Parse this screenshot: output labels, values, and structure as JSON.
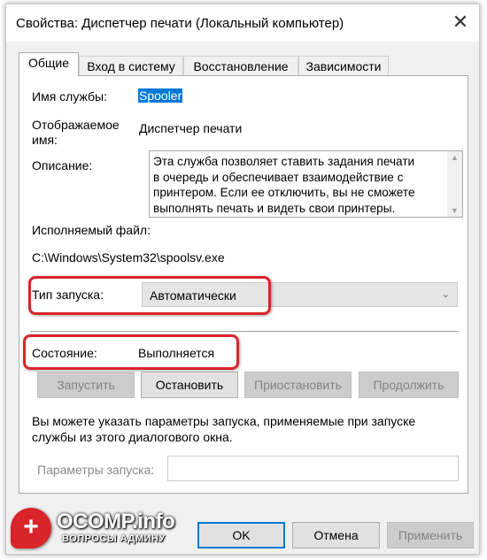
{
  "window": {
    "title": "Свойства: Диспетчер печати (Локальный компьютер)",
    "close_glyph": "✕"
  },
  "tabs": [
    {
      "label": "Общие"
    },
    {
      "label": "Вход в систему"
    },
    {
      "label": "Восстановление"
    },
    {
      "label": "Зависимости"
    }
  ],
  "general": {
    "service_name_label": "Имя службы:",
    "service_name_value": "Spooler",
    "display_name_label_1": "Отображаемое",
    "display_name_label_2": "имя:",
    "display_name_value": "Диспетчер печати",
    "description_label": "Описание:",
    "description_lines": [
      "Эта служба позволяет ставить задания печати",
      "в очередь и обеспечивает взаимодействие с",
      "принтером. Если ее отключить, вы не сможете",
      "выполнять печать и видеть свои принтеры."
    ],
    "exe_label": "Исполняемый файл:",
    "exe_path": "C:\\Windows\\System32\\spoolsv.exe",
    "startup_type_label": "Тип запуска:",
    "startup_type_value": "Автоматически",
    "status_label": "Состояние:",
    "status_value": "Выполняется",
    "start_button": "Запустить",
    "stop_button": "Остановить",
    "pause_button": "Приостановить",
    "resume_button": "Продолжить",
    "hint_line_1": "Вы можете указать параметры запуска, применяемые при запуске",
    "hint_line_2": "службы из этого диалогового окна.",
    "params_label": "Параметры запуска:",
    "params_value": ""
  },
  "footer": {
    "ok_button": "OK",
    "cancel_button": "Отмена",
    "apply_button": "Применить"
  },
  "watermark": {
    "title": "OCOMP.info",
    "subtitle": "ВОПРОСЫ АДМИНУ",
    "icon": "+"
  },
  "colors": {
    "highlight": "#d9252a",
    "selection": "#0078d7"
  }
}
